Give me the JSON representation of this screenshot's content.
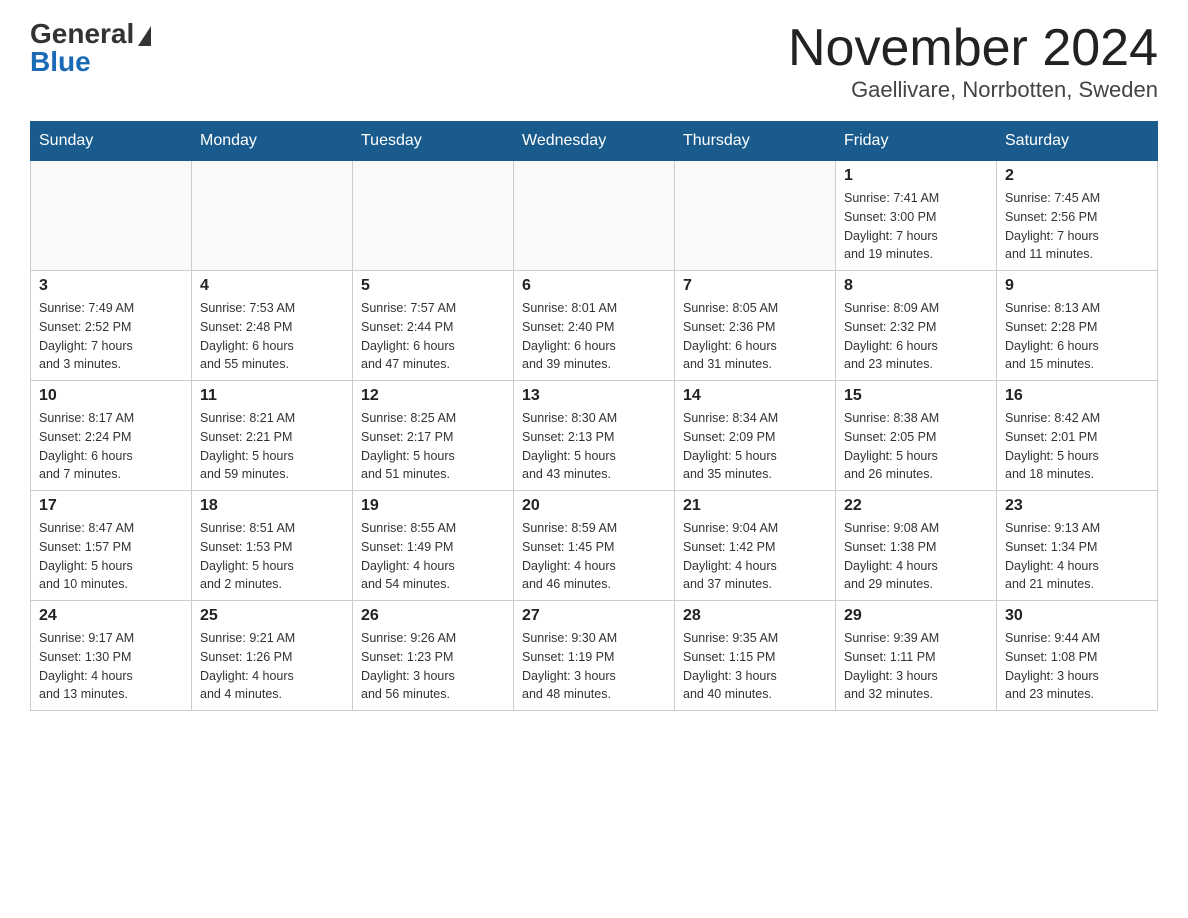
{
  "header": {
    "logo_general": "General",
    "logo_blue": "Blue",
    "title": "November 2024",
    "subtitle": "Gaellivare, Norrbotten, Sweden"
  },
  "weekdays": [
    "Sunday",
    "Monday",
    "Tuesday",
    "Wednesday",
    "Thursday",
    "Friday",
    "Saturday"
  ],
  "weeks": [
    [
      {
        "day": "",
        "detail": ""
      },
      {
        "day": "",
        "detail": ""
      },
      {
        "day": "",
        "detail": ""
      },
      {
        "day": "",
        "detail": ""
      },
      {
        "day": "",
        "detail": ""
      },
      {
        "day": "1",
        "detail": "Sunrise: 7:41 AM\nSunset: 3:00 PM\nDaylight: 7 hours\nand 19 minutes."
      },
      {
        "day": "2",
        "detail": "Sunrise: 7:45 AM\nSunset: 2:56 PM\nDaylight: 7 hours\nand 11 minutes."
      }
    ],
    [
      {
        "day": "3",
        "detail": "Sunrise: 7:49 AM\nSunset: 2:52 PM\nDaylight: 7 hours\nand 3 minutes."
      },
      {
        "day": "4",
        "detail": "Sunrise: 7:53 AM\nSunset: 2:48 PM\nDaylight: 6 hours\nand 55 minutes."
      },
      {
        "day": "5",
        "detail": "Sunrise: 7:57 AM\nSunset: 2:44 PM\nDaylight: 6 hours\nand 47 minutes."
      },
      {
        "day": "6",
        "detail": "Sunrise: 8:01 AM\nSunset: 2:40 PM\nDaylight: 6 hours\nand 39 minutes."
      },
      {
        "day": "7",
        "detail": "Sunrise: 8:05 AM\nSunset: 2:36 PM\nDaylight: 6 hours\nand 31 minutes."
      },
      {
        "day": "8",
        "detail": "Sunrise: 8:09 AM\nSunset: 2:32 PM\nDaylight: 6 hours\nand 23 minutes."
      },
      {
        "day": "9",
        "detail": "Sunrise: 8:13 AM\nSunset: 2:28 PM\nDaylight: 6 hours\nand 15 minutes."
      }
    ],
    [
      {
        "day": "10",
        "detail": "Sunrise: 8:17 AM\nSunset: 2:24 PM\nDaylight: 6 hours\nand 7 minutes."
      },
      {
        "day": "11",
        "detail": "Sunrise: 8:21 AM\nSunset: 2:21 PM\nDaylight: 5 hours\nand 59 minutes."
      },
      {
        "day": "12",
        "detail": "Sunrise: 8:25 AM\nSunset: 2:17 PM\nDaylight: 5 hours\nand 51 minutes."
      },
      {
        "day": "13",
        "detail": "Sunrise: 8:30 AM\nSunset: 2:13 PM\nDaylight: 5 hours\nand 43 minutes."
      },
      {
        "day": "14",
        "detail": "Sunrise: 8:34 AM\nSunset: 2:09 PM\nDaylight: 5 hours\nand 35 minutes."
      },
      {
        "day": "15",
        "detail": "Sunrise: 8:38 AM\nSunset: 2:05 PM\nDaylight: 5 hours\nand 26 minutes."
      },
      {
        "day": "16",
        "detail": "Sunrise: 8:42 AM\nSunset: 2:01 PM\nDaylight: 5 hours\nand 18 minutes."
      }
    ],
    [
      {
        "day": "17",
        "detail": "Sunrise: 8:47 AM\nSunset: 1:57 PM\nDaylight: 5 hours\nand 10 minutes."
      },
      {
        "day": "18",
        "detail": "Sunrise: 8:51 AM\nSunset: 1:53 PM\nDaylight: 5 hours\nand 2 minutes."
      },
      {
        "day": "19",
        "detail": "Sunrise: 8:55 AM\nSunset: 1:49 PM\nDaylight: 4 hours\nand 54 minutes."
      },
      {
        "day": "20",
        "detail": "Sunrise: 8:59 AM\nSunset: 1:45 PM\nDaylight: 4 hours\nand 46 minutes."
      },
      {
        "day": "21",
        "detail": "Sunrise: 9:04 AM\nSunset: 1:42 PM\nDaylight: 4 hours\nand 37 minutes."
      },
      {
        "day": "22",
        "detail": "Sunrise: 9:08 AM\nSunset: 1:38 PM\nDaylight: 4 hours\nand 29 minutes."
      },
      {
        "day": "23",
        "detail": "Sunrise: 9:13 AM\nSunset: 1:34 PM\nDaylight: 4 hours\nand 21 minutes."
      }
    ],
    [
      {
        "day": "24",
        "detail": "Sunrise: 9:17 AM\nSunset: 1:30 PM\nDaylight: 4 hours\nand 13 minutes."
      },
      {
        "day": "25",
        "detail": "Sunrise: 9:21 AM\nSunset: 1:26 PM\nDaylight: 4 hours\nand 4 minutes."
      },
      {
        "day": "26",
        "detail": "Sunrise: 9:26 AM\nSunset: 1:23 PM\nDaylight: 3 hours\nand 56 minutes."
      },
      {
        "day": "27",
        "detail": "Sunrise: 9:30 AM\nSunset: 1:19 PM\nDaylight: 3 hours\nand 48 minutes."
      },
      {
        "day": "28",
        "detail": "Sunrise: 9:35 AM\nSunset: 1:15 PM\nDaylight: 3 hours\nand 40 minutes."
      },
      {
        "day": "29",
        "detail": "Sunrise: 9:39 AM\nSunset: 1:11 PM\nDaylight: 3 hours\nand 32 minutes."
      },
      {
        "day": "30",
        "detail": "Sunrise: 9:44 AM\nSunset: 1:08 PM\nDaylight: 3 hours\nand 23 minutes."
      }
    ]
  ]
}
